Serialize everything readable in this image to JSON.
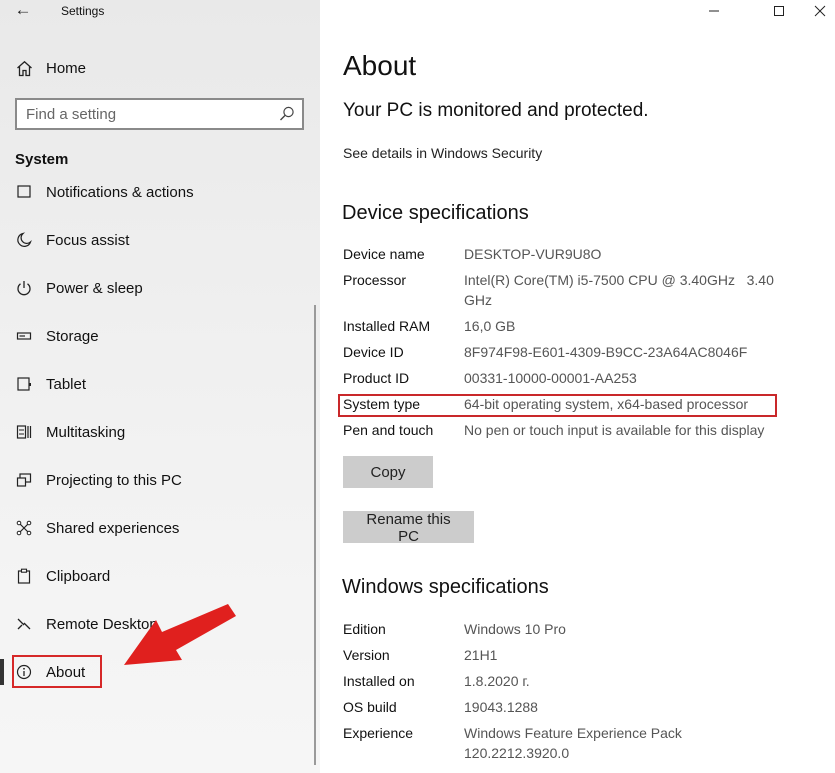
{
  "window": {
    "title": "Settings"
  },
  "sidebar": {
    "home_label": "Home",
    "search_placeholder": "Find a setting",
    "section_label": "System",
    "items": [
      {
        "label": "Notifications & actions",
        "icon": "notifications-icon"
      },
      {
        "label": "Focus assist",
        "icon": "moon-icon"
      },
      {
        "label": "Power & sleep",
        "icon": "power-icon"
      },
      {
        "label": "Storage",
        "icon": "storage-icon"
      },
      {
        "label": "Tablet",
        "icon": "tablet-icon"
      },
      {
        "label": "Multitasking",
        "icon": "multitasking-icon"
      },
      {
        "label": "Projecting to this PC",
        "icon": "projecting-icon"
      },
      {
        "label": "Shared experiences",
        "icon": "shared-icon"
      },
      {
        "label": "Clipboard",
        "icon": "clipboard-icon"
      },
      {
        "label": "Remote Desktop",
        "icon": "remote-desktop-icon"
      },
      {
        "label": "About",
        "icon": "info-icon",
        "selected": true
      }
    ]
  },
  "main": {
    "title": "About",
    "protection_status": "Your PC is monitored and protected.",
    "security_link": "See details in Windows Security",
    "device_heading": "Device specifications",
    "device_specs": [
      {
        "key": "Device name",
        "value": "DESKTOP-VUR9U8O"
      },
      {
        "key": "Processor",
        "value": "Intel(R) Core(TM) i5-7500 CPU @ 3.40GHz   3.40 GHz"
      },
      {
        "key": "Installed RAM",
        "value": "16,0 GB"
      },
      {
        "key": "Device ID",
        "value": "8F974F98-E601-4309-B9CC-23A64AC8046F"
      },
      {
        "key": "Product ID",
        "value": "00331-10000-00001-AA253"
      },
      {
        "key": "System type",
        "value": "64-bit operating system, x64-based processor"
      },
      {
        "key": "Pen and touch",
        "value": "No pen or touch input is available for this display"
      }
    ],
    "copy_button": "Copy",
    "rename_button": "Rename this PC",
    "windows_heading": "Windows specifications",
    "windows_specs": [
      {
        "key": "Edition",
        "value": "Windows 10 Pro"
      },
      {
        "key": "Version",
        "value": "21H1"
      },
      {
        "key": "Installed on",
        "value": "1.8.2020 г."
      },
      {
        "key": "OS build",
        "value": "19043.1288"
      },
      {
        "key": "Experience",
        "value": "Windows Feature Experience Pack 120.2212.3920.0"
      }
    ]
  },
  "colors": {
    "annotation_red": "#d62828",
    "button_gray": "#cccccc",
    "sidebar_bg": "#ececec"
  }
}
